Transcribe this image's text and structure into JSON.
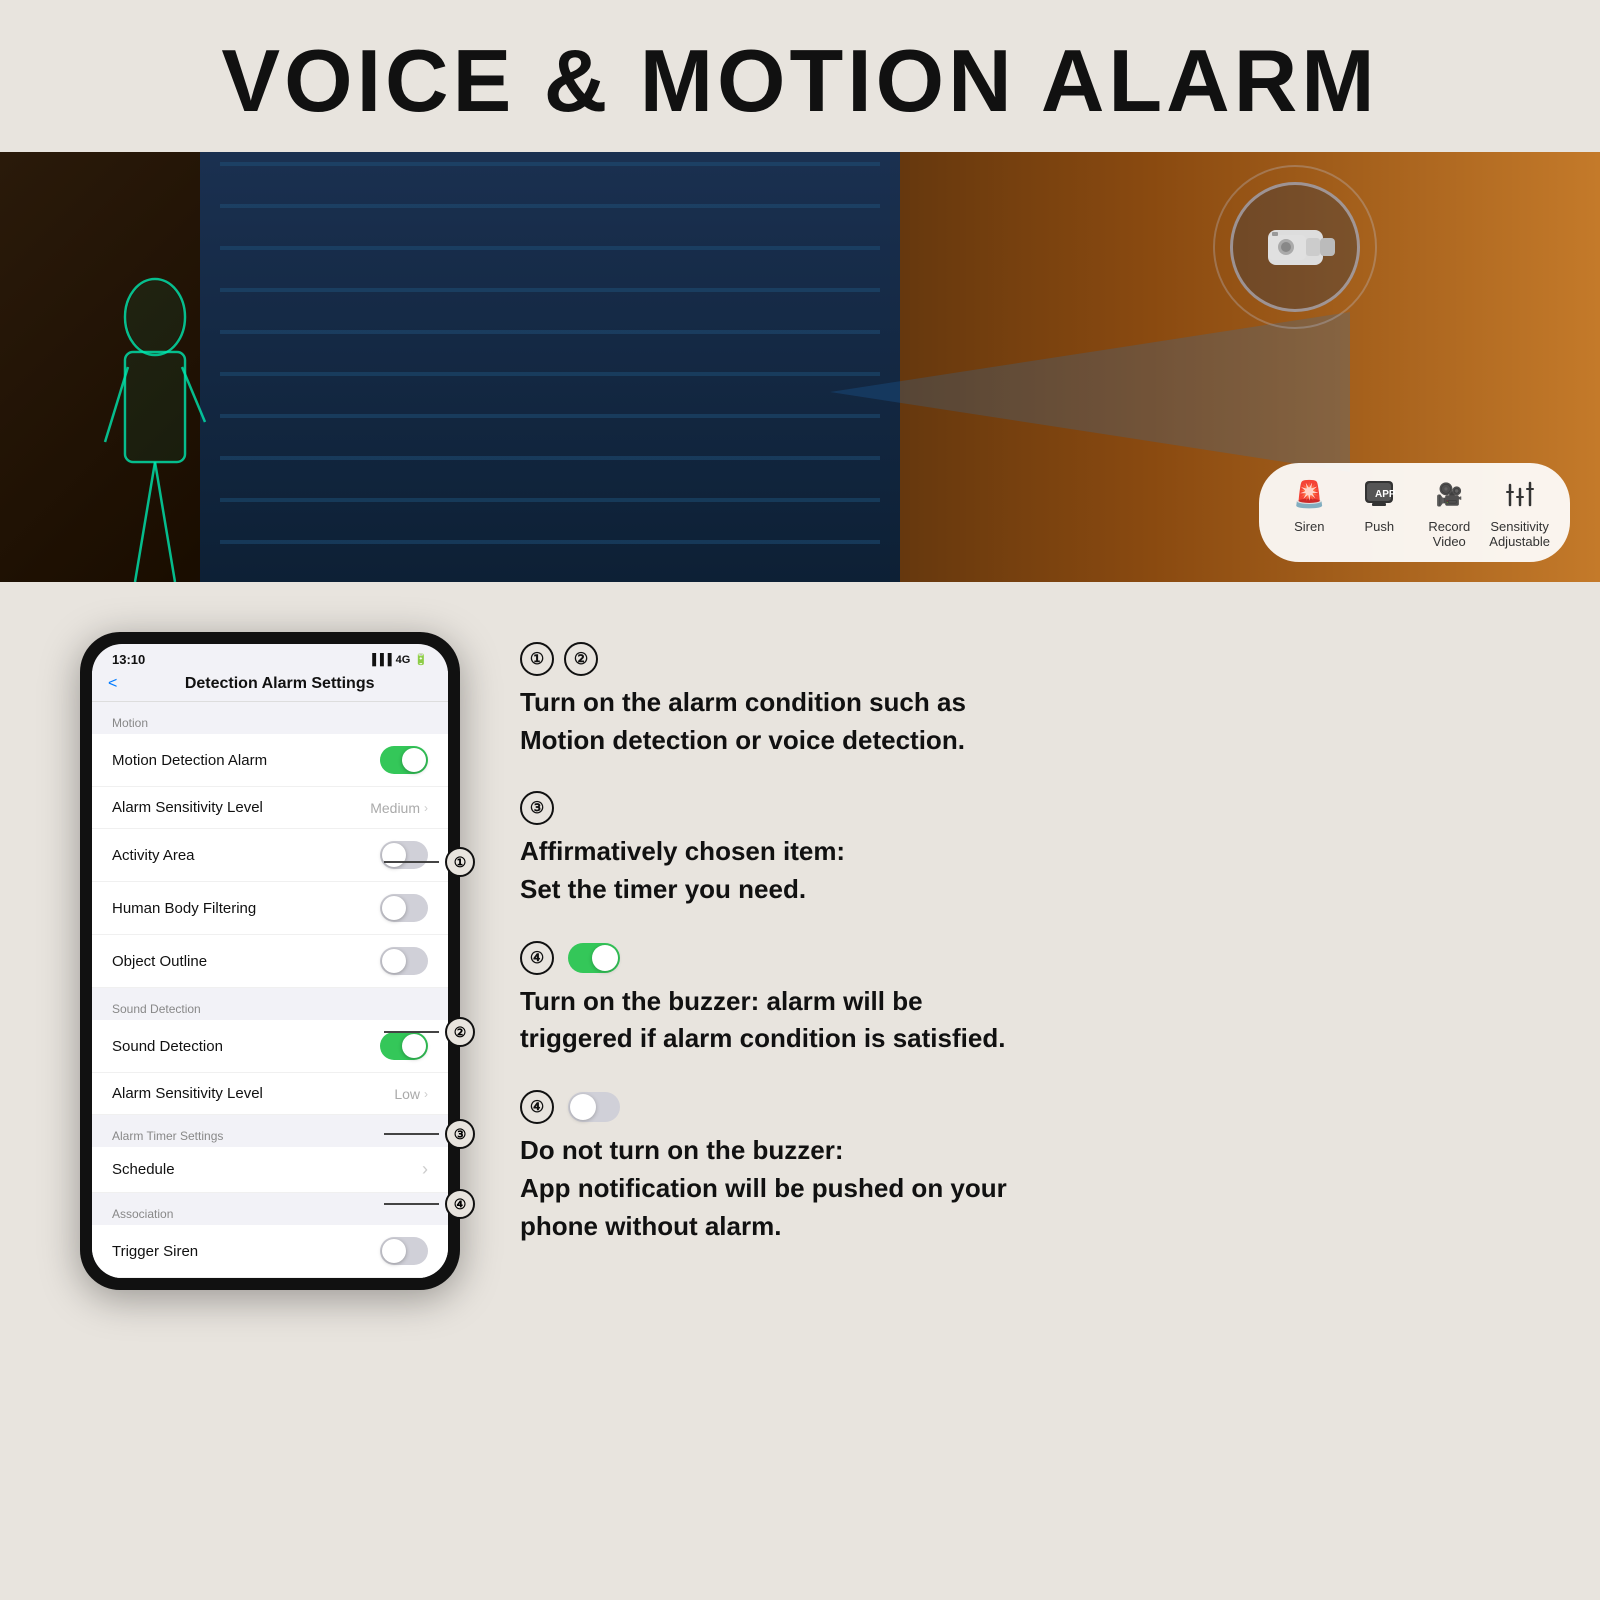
{
  "header": {
    "title": "VOICE & MOTION ALARM"
  },
  "hero": {
    "features": [
      {
        "id": "siren",
        "icon": "🚨",
        "label": "Siren"
      },
      {
        "id": "push",
        "icon": "📱",
        "label": "Push"
      },
      {
        "id": "record",
        "icon": "🎥",
        "label": "Record\nVideo"
      },
      {
        "id": "sensitivity",
        "icon": "🎚️",
        "label": "Sensitivity\nAdjustable"
      }
    ]
  },
  "phone": {
    "statusbar": {
      "time": "13:10",
      "signal": "▐▐▐ 4G 🔋"
    },
    "header_title": "Detection Alarm Settings",
    "back_label": "<",
    "sections": [
      {
        "label": "Motion",
        "rows": [
          {
            "id": "motion-detection",
            "label": "Motion Detection Alarm",
            "control": "toggle-on",
            "annotation": "①"
          },
          {
            "id": "alarm-sensitivity-motion",
            "label": "Alarm Sensitivity Level",
            "control": "value",
            "value": "Medium"
          },
          {
            "id": "activity-area",
            "label": "Activity Area",
            "control": "toggle-off"
          },
          {
            "id": "human-body",
            "label": "Human Body Filtering",
            "control": "toggle-off"
          },
          {
            "id": "object-outline",
            "label": "Object Outline",
            "control": "toggle-off"
          }
        ]
      },
      {
        "label": "Sound Detection",
        "rows": [
          {
            "id": "sound-detection",
            "label": "Sound Detection",
            "control": "toggle-on",
            "annotation": "②"
          },
          {
            "id": "alarm-sensitivity-sound",
            "label": "Alarm Sensitivity Level",
            "control": "value",
            "value": "Low"
          }
        ]
      },
      {
        "label": "Alarm Timer Settings",
        "rows": [
          {
            "id": "schedule",
            "label": "Schedule",
            "control": "chevron",
            "annotation": "③"
          }
        ]
      },
      {
        "label": "Association",
        "rows": [
          {
            "id": "trigger-siren",
            "label": "Trigger Siren",
            "control": "toggle-off",
            "annotation": "④"
          }
        ]
      }
    ]
  },
  "descriptions": [
    {
      "numbers": "① ②",
      "text": "Turn on the alarm condition such as\nMotion detection or voice detection."
    },
    {
      "numbers": "③",
      "text": "Affirmatively chosen item:\nSet the timer you need."
    },
    {
      "numbers": "④",
      "toggle_state": "on",
      "text": "Turn on the buzzer: alarm will be\ntriggered if alarm condition is satisfied."
    },
    {
      "numbers": "④",
      "toggle_state": "off",
      "text": "Do not turn on the buzzer:\nApp notification will be pushed on your\nphone without alarm."
    }
  ]
}
